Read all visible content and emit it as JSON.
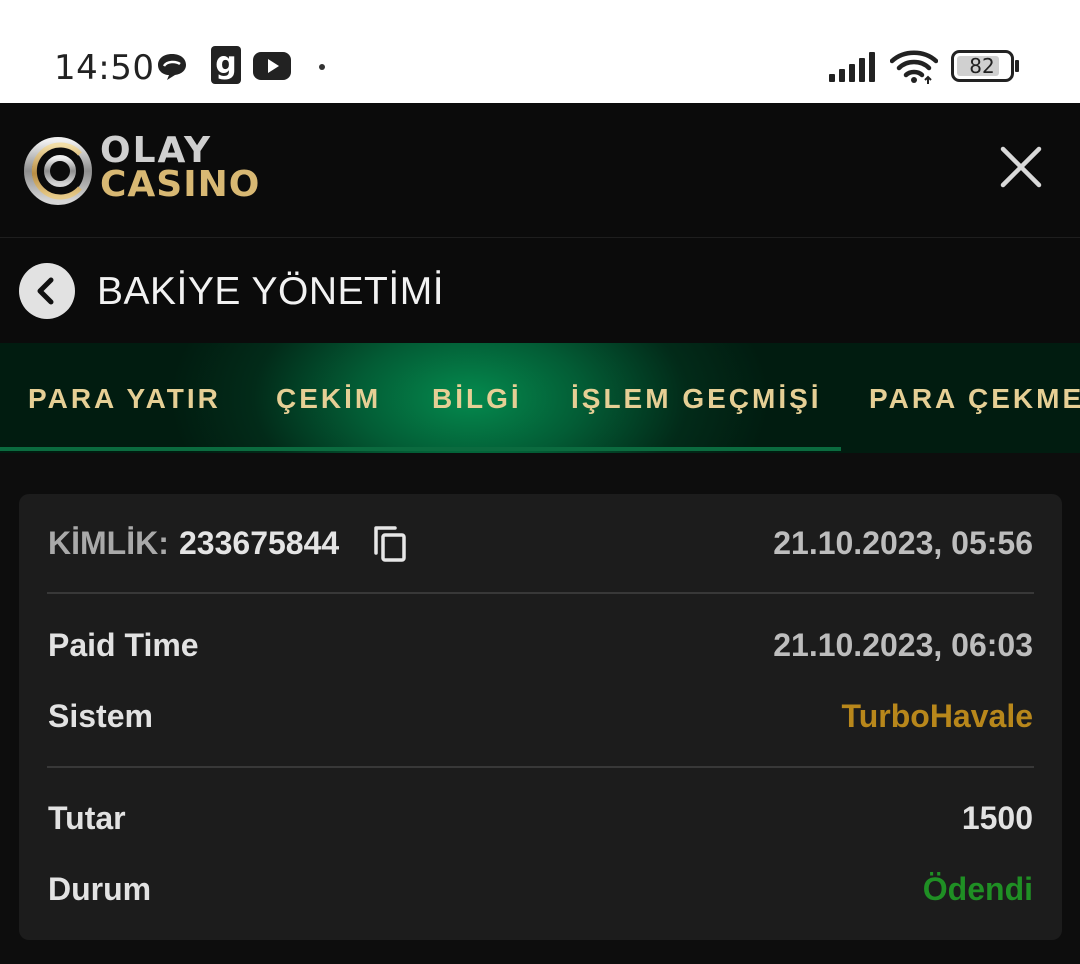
{
  "status_bar": {
    "time": "14:50",
    "battery_level": "82",
    "icons": [
      "chat-bubble-icon",
      "g-app-icon",
      "youtube-icon",
      "dot-icon",
      "signal-icon",
      "wifi-icon",
      "battery-icon"
    ]
  },
  "header": {
    "logo_line1": "OLAY",
    "logo_line2": "CASINO",
    "close_icon": "close-icon"
  },
  "page": {
    "back_icon": "chevron-left-icon",
    "title": "BAKİYE YÖNETİMİ"
  },
  "tabs": [
    {
      "label": "PARA YATIR"
    },
    {
      "label": "ÇEKİM"
    },
    {
      "label": "BİLGİ"
    },
    {
      "label": "İŞLEM GEÇMİŞİ"
    },
    {
      "label": "PARA ÇEKME"
    }
  ],
  "transaction": {
    "id_label": "KİMLİK:",
    "id_value": "233675844",
    "created_at": "21.10.2023, 05:56",
    "paid_time_label": "Paid Time",
    "paid_time_value": "21.10.2023, 06:03",
    "system_label": "Sistem",
    "system_value": "TurboHavale",
    "amount_label": "Tutar",
    "amount_value": "1500",
    "status_label": "Durum",
    "status_value": "Ödendi"
  },
  "colors": {
    "gold_tab_text": "#e6cf95",
    "system_value": "#b8871b",
    "status_paid": "#1f8f24",
    "tab_green": "#048a4e",
    "background": "#0d0d0d",
    "card": "#1c1c1c"
  }
}
